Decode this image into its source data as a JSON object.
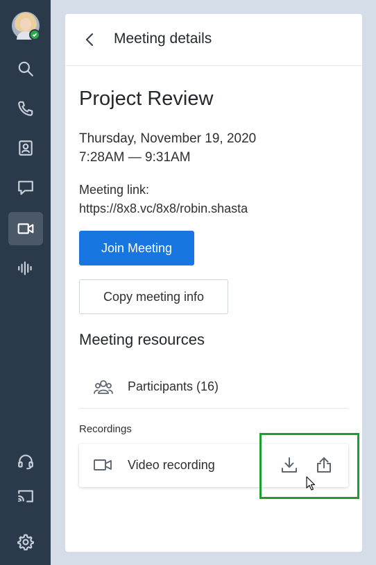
{
  "sidebar": {
    "items": [
      {
        "icon": "search-icon"
      },
      {
        "icon": "phone-icon"
      },
      {
        "icon": "contacts-icon"
      },
      {
        "icon": "chat-icon"
      },
      {
        "icon": "video-icon",
        "active": true
      },
      {
        "icon": "voicemail-icon"
      }
    ],
    "bottom_items": [
      {
        "icon": "headset-icon"
      },
      {
        "icon": "cast-icon"
      },
      {
        "icon": "gear-icon"
      }
    ],
    "avatar_status": "online"
  },
  "header": {
    "title": "Meeting details"
  },
  "meeting": {
    "name": "Project Review",
    "date": "Thursday, November 19, 2020",
    "time": "7:28AM — 9:31AM",
    "link_label": "Meeting link:",
    "link_url": "https://8x8.vc/8x8/robin.shasta"
  },
  "actions": {
    "join_label": "Join Meeting",
    "copy_label": "Copy meeting info"
  },
  "resources": {
    "heading": "Meeting resources",
    "participants_label": "Participants (16)"
  },
  "recordings": {
    "section_label": "Recordings",
    "item_label": "Video recording"
  },
  "colors": {
    "rail_bg": "#2b3a4b",
    "accent": "#1776e0",
    "highlight": "#1f9d30",
    "status_online": "#2aa84a"
  }
}
